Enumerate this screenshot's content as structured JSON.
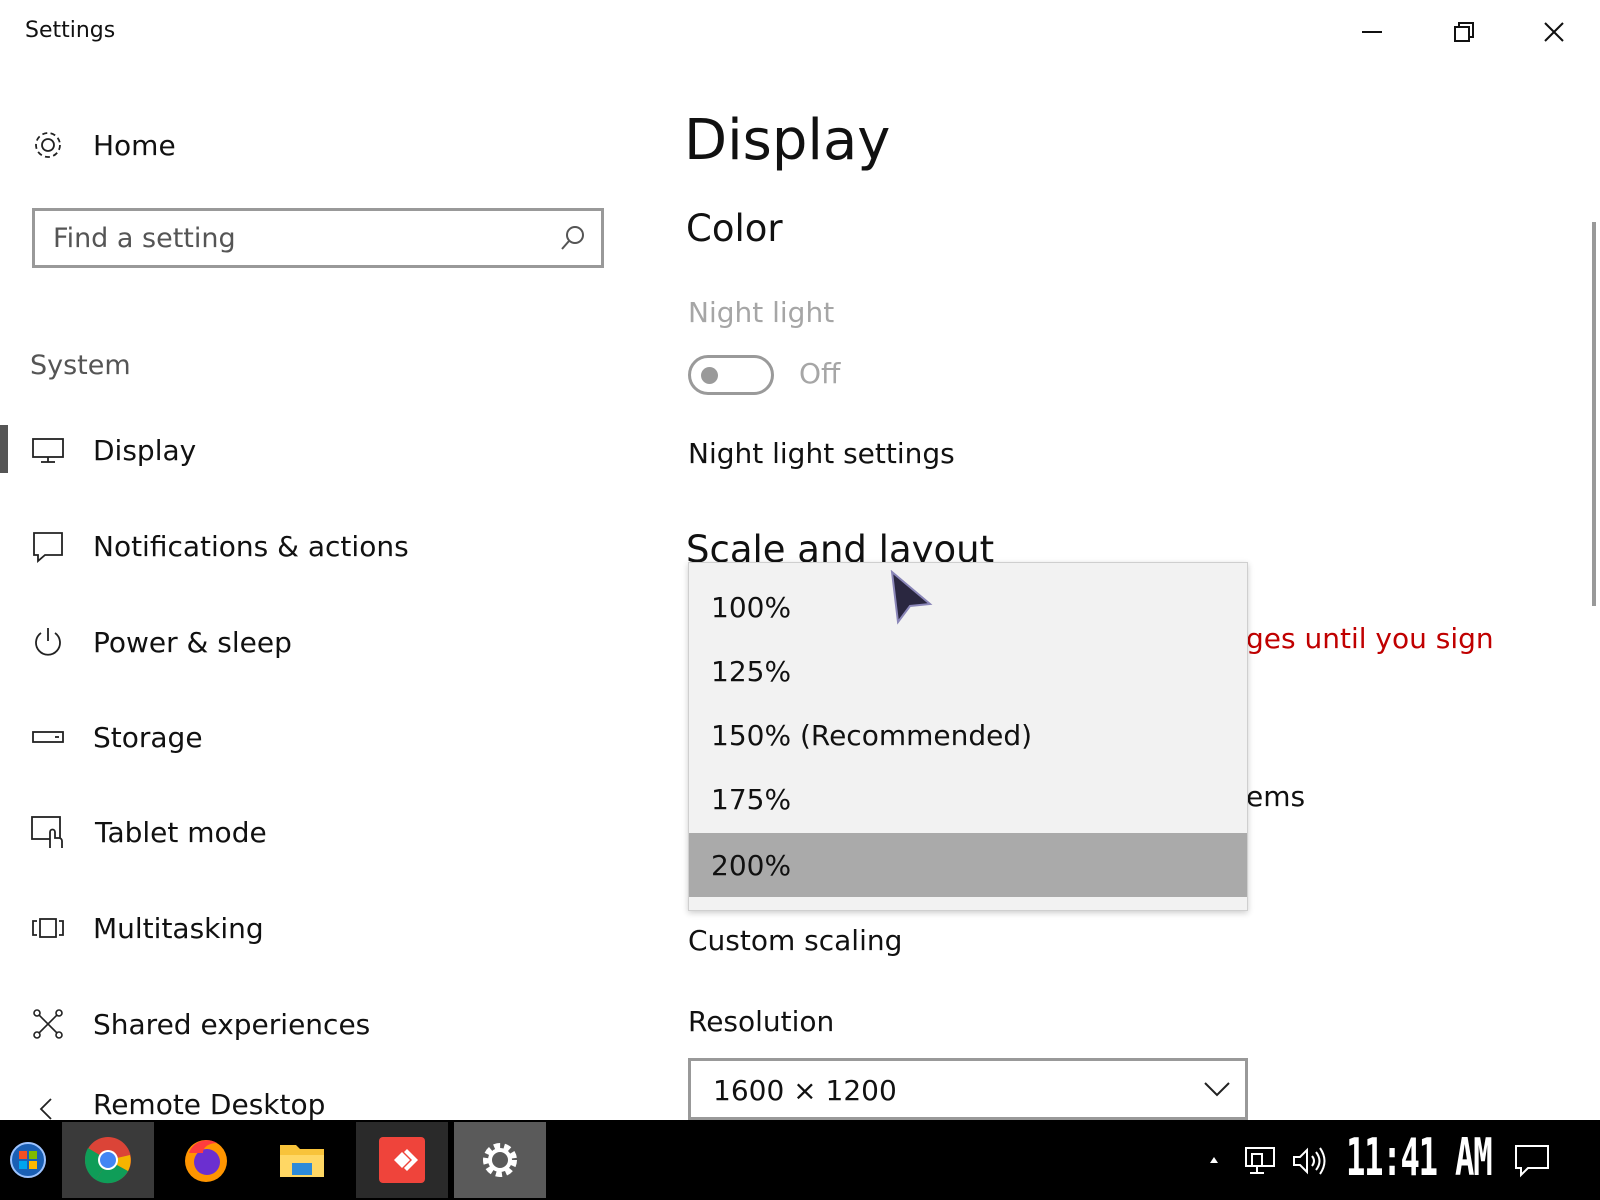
{
  "window": {
    "title": "Settings",
    "controls": {
      "minimize": "minimize",
      "maximize": "restore",
      "close": "close"
    }
  },
  "sidebar": {
    "home_label": "Home",
    "search_placeholder": "Find a setting",
    "section_label": "System",
    "items": [
      {
        "label": "Display",
        "icon": "monitor-icon",
        "selected": true
      },
      {
        "label": "Notifications & actions",
        "icon": "notification-icon"
      },
      {
        "label": "Power & sleep",
        "icon": "power-icon"
      },
      {
        "label": "Storage",
        "icon": "storage-icon"
      },
      {
        "label": "Tablet mode",
        "icon": "tablet-mode-icon"
      },
      {
        "label": "Multitasking",
        "icon": "multitasking-icon"
      },
      {
        "label": "Shared experiences",
        "icon": "shared-experiences-icon"
      },
      {
        "label": "Remote Desktop",
        "icon": "remote-desktop-icon"
      }
    ]
  },
  "main": {
    "page_title": "Display",
    "color_heading": "Color",
    "night_light_label": "Night light",
    "night_light_state": "Off",
    "night_light_settings_link": "Night light settings",
    "scale_heading": "Scale and layout",
    "warning_partial": "ges until you sign",
    "items_partial": "ems",
    "custom_scaling_link": "Custom scaling",
    "resolution_label": "Resolution",
    "resolution_value": "1600 × 1200"
  },
  "scale_dropdown": {
    "options": [
      "100%",
      "125%",
      "150% (Recommended)",
      "175%",
      "200%"
    ],
    "selected": "200%"
  },
  "taskbar": {
    "apps": [
      "start-button",
      "chrome",
      "firefox",
      "file-explorer",
      "anydesk",
      "settings"
    ],
    "clock": "11:41 AM"
  },
  "colors": {
    "accent_selected_bar": "#555555",
    "warning_red": "#c00000",
    "taskbar_bg": "#000000",
    "dropdown_bg": "#f2f2f2",
    "dropdown_selected": "#aaaaaa"
  }
}
